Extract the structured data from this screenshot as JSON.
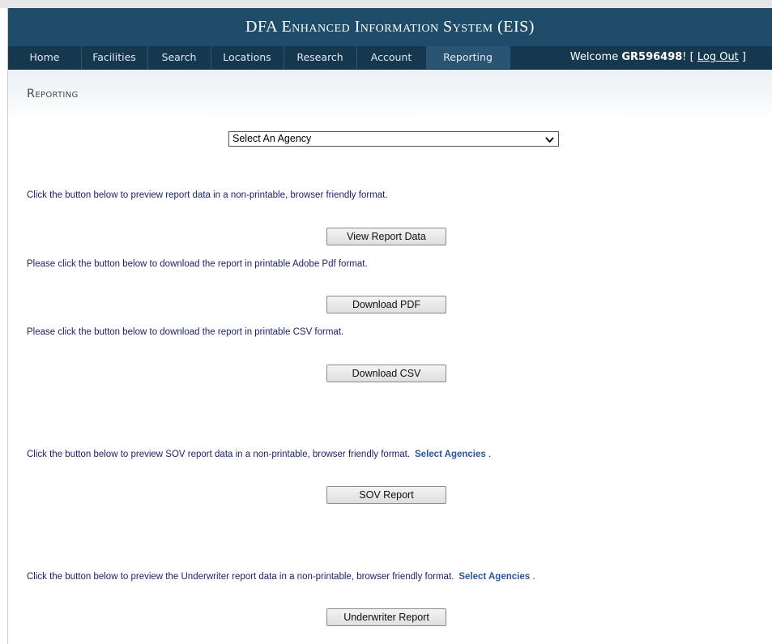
{
  "header": {
    "title_prefix": "DFA ",
    "title_sc": "Enhanced Information System",
    "title_suffix": " (EIS)"
  },
  "nav": {
    "items": [
      "Home",
      "Facilities",
      "Search",
      "Locations",
      "Research",
      "Account",
      "Reporting"
    ],
    "active": "Reporting",
    "welcome_text": "Welcome ",
    "username": "GR596498",
    "after_user": "! [ ",
    "logout_label": "Log Out",
    "close_bracket": " ]"
  },
  "page": {
    "title": "Reporting"
  },
  "agency_select": {
    "selected": "Select An Agency"
  },
  "sections": {
    "preview_text": "Click the button below to preview report data in a non-printable, browser friendly format.",
    "view_button": "View Report Data",
    "pdf_text": "Please click the button below to download the report in printable Adobe Pdf format.",
    "pdf_button": "Download PDF",
    "csv_text": "Please click the button below to download the report in printable CSV format.",
    "csv_button": "Download CSV",
    "sov_text": "Click the button below to preview SOV report data in a non-printable, browser friendly format.",
    "sov_link": "Select Agencies",
    "sov_button": "SOV Report",
    "uw_text": "Click the button below to preview the Underwriter report data in a non-printable, browser friendly format.",
    "uw_link": "Select Agencies",
    "uw_button": "Underwriter Report",
    "period": "."
  }
}
